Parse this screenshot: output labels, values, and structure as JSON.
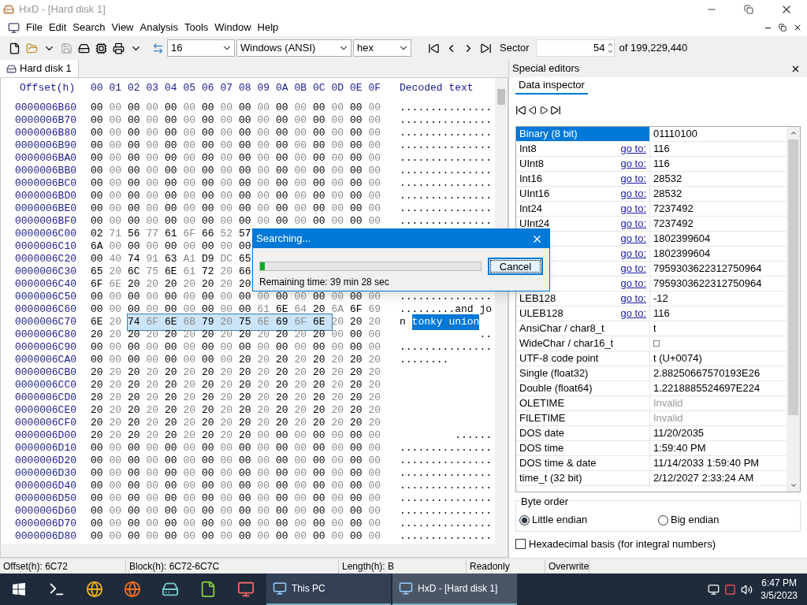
{
  "window": {
    "title": "HxD - [Hard disk 1]"
  },
  "menu": [
    "File",
    "Edit",
    "Search",
    "View",
    "Analysis",
    "Tools",
    "Window",
    "Help"
  ],
  "toolbar": {
    "bytes_per_row": "16",
    "charset": "Windows (ANSI)",
    "offset_base": "hex",
    "sector_label": "Sector",
    "sector": "54",
    "sector_total": "of 199,229,440"
  },
  "document_tab": {
    "label": "Hard disk 1",
    "selected": true
  },
  "hex": {
    "offset_header": "Offset(h)",
    "columns": [
      "00",
      "01",
      "02",
      "03",
      "04",
      "05",
      "06",
      "07",
      "08",
      "09",
      "0A",
      "0B",
      "0C",
      "0D",
      "0E",
      "0F"
    ],
    "decoded_header": "Decoded text",
    "rows": [
      {
        "offset": "0000006B60",
        "bytes": [
          {
            "text": "00 00 00 00 00 00 00 00 00 00 00 00 00 00 00 00",
            "selected": false
          }
        ],
        "decoded": [
          {
            "text": "...............",
            "selected": false
          }
        ]
      },
      {
        "offset": "0000006B70",
        "bytes": [
          {
            "text": "00 00 00 00 00 00 00 00 00 00 00 00 00 00 00 00",
            "selected": false
          }
        ],
        "decoded": [
          {
            "text": "...............",
            "selected": false
          }
        ]
      },
      {
        "offset": "0000006B80",
        "bytes": [
          {
            "text": "00 00 00 00 00 00 00 00 00 00 00 00 00 00 00 00",
            "selected": false
          }
        ],
        "decoded": [
          {
            "text": "...............",
            "selected": false
          }
        ]
      },
      {
        "offset": "0000006B90",
        "bytes": [
          {
            "text": "00 00 00 00 00 00 00 00 00 00 00 00 00 00 00 00",
            "selected": false
          }
        ],
        "decoded": [
          {
            "text": "...............",
            "selected": false
          }
        ]
      },
      {
        "offset": "0000006BA0",
        "bytes": [
          {
            "text": "00 00 00 00 00 00 00 00 00 00 00 00 00 00 00 00",
            "selected": false
          }
        ],
        "decoded": [
          {
            "text": "...............",
            "selected": false
          }
        ]
      },
      {
        "offset": "0000006BB0",
        "bytes": [
          {
            "text": "00 00 00 00 00 00 00 00 00 00 00 00 00 00 00 00",
            "selected": false
          }
        ],
        "decoded": [
          {
            "text": "...............",
            "selected": false
          }
        ]
      },
      {
        "offset": "0000006BC0",
        "bytes": [
          {
            "text": "00 00 00 00 00 00 00 00 00 00 00 00 00 00 00 00",
            "selected": false
          }
        ],
        "decoded": [
          {
            "text": "...............",
            "selected": false
          }
        ]
      },
      {
        "offset": "0000006BD0",
        "bytes": [
          {
            "text": "00 00 00 00 00 00 00 00 00 00 00 00 00 00 00 00",
            "selected": false
          }
        ],
        "decoded": [
          {
            "text": "...............",
            "selected": false
          }
        ]
      },
      {
        "offset": "0000006BE0",
        "bytes": [
          {
            "text": "00 00 00 00 00 00 00 00 00 00 00 00 00 00 00 00",
            "selected": false
          }
        ],
        "decoded": [
          {
            "text": "...............",
            "selected": false
          }
        ]
      },
      {
        "offset": "0000006BF0",
        "bytes": [
          {
            "text": "00 00 00 00 00 00 00 00 00 00 00 00 00 00 00 00",
            "selected": false
          }
        ],
        "decoded": [
          {
            "text": "...............",
            "selected": false
          }
        ]
      },
      {
        "offset": "0000006C00",
        "bytes": [
          {
            "text": "02 71 56 77 61 6F 66 52 57",
            "selected": false
          }
        ]
      },
      {
        "offset": "0000006C10",
        "bytes": [
          {
            "text": "6A 00 00 00 00 00 00 00 00",
            "selected": false
          }
        ]
      },
      {
        "offset": "0000006C20",
        "bytes": [
          {
            "text": "00 40 74 91 63 A1 D9 DC 65",
            "selected": false
          }
        ]
      },
      {
        "offset": "0000006C30",
        "bytes": [
          {
            "text": "65 20 6C 75 6E 61 72 20 66",
            "selected": false
          }
        ]
      },
      {
        "offset": "0000006C40",
        "bytes": [
          {
            "text": "6F 6E 20 20 20 20 20 20 20",
            "selected": false
          }
        ]
      },
      {
        "offset": "0000006C50",
        "bytes": [
          {
            "text": "00 00 00 00 00 00 00 00 00 00 00 00 00 00 00 00",
            "selected": false
          }
        ],
        "decoded": [
          {
            "text": "...............",
            "selected": false
          }
        ]
      },
      {
        "offset": "0000006C60",
        "bytes": [
          {
            "text": "00 00 00 00 00 00 00 00 00 61 6E 64 20 6A 6F 69",
            "selected": false
          }
        ],
        "decoded": [
          {
            "text": ".........and jo",
            "selected": false
          }
        ]
      },
      {
        "offset": "0000006C70",
        "bytes": [
          {
            "text": "6E 20",
            "selected": false
          },
          {
            "text": "74 6F 6E 6B 79 20 75 6E 69 6F 6E",
            "selected": true
          },
          {
            "text": "20 20 20",
            "selected": false
          }
        ],
        "decoded": [
          {
            "text": "n ",
            "selected": false
          },
          {
            "text": "tonky union",
            "selected": true
          }
        ]
      },
      {
        "offset": "0000006C80",
        "bytes": [
          {
            "text": "20 20 20 20 20 20 20 20 20 20 20 20 20 00 00 00",
            "selected": false
          }
        ],
        "decoded": [
          {
            "text": "             ..",
            "selected": false
          }
        ]
      },
      {
        "offset": "0000006C90",
        "bytes": [
          {
            "text": "00 00 00 00 00 00 00 00 00 00 00 00 00 00 00 00",
            "selected": false
          }
        ],
        "decoded": [
          {
            "text": "...............",
            "selected": false
          }
        ]
      },
      {
        "offset": "0000006CA0",
        "bytes": [
          {
            "text": "00 00 00 00 00 00 00 00 20 20 20 20 20 20 20 20",
            "selected": false
          }
        ],
        "decoded": [
          {
            "text": "........",
            "selected": false
          }
        ]
      },
      {
        "offset": "0000006CB0",
        "bytes": [
          {
            "text": "20 20 20 20 20 20 20 20 20 20 20 20 20 20 20 20",
            "selected": false
          }
        ]
      },
      {
        "offset": "0000006CC0",
        "bytes": [
          {
            "text": "20 20 20 20 20 20 20 20 20 20 20 20 20 20 20 20",
            "selected": false
          }
        ]
      },
      {
        "offset": "0000006CD0",
        "bytes": [
          {
            "text": "20 20 20 20 20 20 20 20 20 20 20 20 20 20 20 20",
            "selected": false
          }
        ]
      },
      {
        "offset": "0000006CE0",
        "bytes": [
          {
            "text": "20 20 20 20 20 20 20 20 20 20 20 20 20 20 20 20",
            "selected": false
          }
        ]
      },
      {
        "offset": "0000006CF0",
        "bytes": [
          {
            "text": "20 20 20 20 20 20 20 20 20 20 20 20 20 20 20 20",
            "selected": false
          }
        ]
      },
      {
        "offset": "0000006D00",
        "bytes": [
          {
            "text": "20 20 20 20 20 20 20 20 20 00 00 00 00 00 00 00",
            "selected": false
          }
        ],
        "decoded": [
          {
            "text": "         ......",
            "selected": false
          }
        ]
      },
      {
        "offset": "0000006D10",
        "bytes": [
          {
            "text": "00 00 00 00 00 00 00 00 00 00 00 00 00 00 00 00",
            "selected": false
          }
        ],
        "decoded": [
          {
            "text": "...............",
            "selected": false
          }
        ]
      },
      {
        "offset": "0000006D20",
        "bytes": [
          {
            "text": "00 00 00 00 00 00 00 00 00 00 00 00 00 00 00 00",
            "selected": false
          }
        ],
        "decoded": [
          {
            "text": "...............",
            "selected": false
          }
        ]
      },
      {
        "offset": "0000006D30",
        "bytes": [
          {
            "text": "00 00 00 00 00 00 00 00 00 00 00 00 00 00 00 00",
            "selected": false
          }
        ],
        "decoded": [
          {
            "text": "...............",
            "selected": false
          }
        ]
      },
      {
        "offset": "0000006D40",
        "bytes": [
          {
            "text": "00 00 00 00 00 00 00 00 00 00 00 00 00 00 00 00",
            "selected": false
          }
        ],
        "decoded": [
          {
            "text": "...............",
            "selected": false
          }
        ]
      },
      {
        "offset": "0000006D50",
        "bytes": [
          {
            "text": "00 00 00 00 00 00 00 00 00 00 00 00 00 00 00 00",
            "selected": false
          }
        ],
        "decoded": [
          {
            "text": "...............",
            "selected": false
          }
        ]
      },
      {
        "offset": "0000006D60",
        "bytes": [
          {
            "text": "00 00 00 00 00 00 00 00 00 00 00 00 00 00 00 00",
            "selected": false
          }
        ],
        "decoded": [
          {
            "text": "...............",
            "selected": false
          }
        ]
      },
      {
        "offset": "0000006D70",
        "bytes": [
          {
            "text": "00 00 00 00 00 00 00 00 00 00 00 00 00 00 00 00",
            "selected": false
          }
        ],
        "decoded": [
          {
            "text": "...............",
            "selected": false
          }
        ]
      },
      {
        "offset": "0000006D80",
        "bytes": [
          {
            "text": "00 00 00 00 00 00 00 00 00 00 00 00 00 00 00 00",
            "selected": false
          }
        ],
        "decoded": [
          {
            "text": "...............",
            "selected": false
          }
        ]
      }
    ]
  },
  "dialog": {
    "title": "Searching...",
    "level": 0.02,
    "remaining": "Remaining time: 39 min 28 sec",
    "button": "Cancel"
  },
  "special_editors": {
    "title": "Special editors",
    "tab": {
      "label": "Data inspector",
      "selected": true
    },
    "rows": [
      {
        "label": "Binary (8 bit)",
        "value": "01110100",
        "selected": true,
        "dimmed": false
      },
      {
        "label": "Int8",
        "link": "go to:",
        "value": "116",
        "selected": false,
        "dimmed": false
      },
      {
        "label": "UInt8",
        "link": "go to:",
        "value": "116",
        "selected": false,
        "dimmed": false
      },
      {
        "label": "Int16",
        "link": "go to:",
        "value": "28532",
        "selected": false,
        "dimmed": false
      },
      {
        "label": "UInt16",
        "link": "go to:",
        "value": "28532",
        "selected": false,
        "dimmed": false
      },
      {
        "label": "Int24",
        "link": "go to:",
        "value": "7237492",
        "selected": false,
        "dimmed": false
      },
      {
        "label": "UInt24",
        "link": "go to:",
        "value": "7237492",
        "selected": false,
        "dimmed": false
      },
      {
        "link": "go to:",
        "value": "1802399604",
        "selected": false,
        "dimmed": false
      },
      {
        "link": "go to:",
        "value": "1802399604",
        "selected": false,
        "dimmed": false
      },
      {
        "link": "go to:",
        "value": "7959303622312750964",
        "selected": false,
        "dimmed": false
      },
      {
        "link": "go to:",
        "value": "7959303622312750964",
        "selected": false,
        "dimmed": false
      },
      {
        "label": "LEB128",
        "link": "go to:",
        "value": "-12",
        "selected": false,
        "dimmed": false
      },
      {
        "label": "ULEB128",
        "link": "go to:",
        "value": "116",
        "selected": false,
        "dimmed": false
      },
      {
        "label": "AnsiChar / char8_t",
        "value": "t",
        "selected": false,
        "dimmed": false
      },
      {
        "label": "WideChar / char16_t",
        "value": "□",
        "selected": false,
        "dimmed": false
      },
      {
        "label": "UTF-8 code point",
        "value": "t (U+0074)",
        "selected": false,
        "dimmed": false
      },
      {
        "label": "Single (float32)",
        "value": "2.88250667570193E26",
        "selected": false,
        "dimmed": false
      },
      {
        "label": "Double (float64)",
        "value": "1.2218885524697E224",
        "selected": false,
        "dimmed": false
      },
      {
        "label": "OLETIME",
        "value": "Invalid",
        "selected": false,
        "dimmed": true
      },
      {
        "label": "FILETIME",
        "value": "Invalid",
        "selected": false,
        "dimmed": true
      },
      {
        "label": "DOS date",
        "value": "11/20/2035",
        "selected": false,
        "dimmed": false
      },
      {
        "label": "DOS time",
        "value": "1:59:40 PM",
        "selected": false,
        "dimmed": false
      },
      {
        "label": "DOS time & date",
        "value": "11/14/2033 1:59:40 PM",
        "selected": false,
        "dimmed": false
      },
      {
        "label": "time_t (32 bit)",
        "value": "2/12/2027 2:33:24 AM",
        "selected": false,
        "dimmed": false
      }
    ],
    "byte_order": {
      "title": "Byte order",
      "options": [
        {
          "label": "Little endian",
          "selected": true
        },
        {
          "label": "Big endian",
          "selected": false
        }
      ]
    },
    "hex_basis": {
      "label": "Hexadecimal basis (for integral numbers)",
      "checked": false
    }
  },
  "status_bar": [
    "Offset(h): 6C72",
    "Block(h): 6C72-6C7C",
    "Length(h): B",
    "Readonly",
    "Overwrite"
  ],
  "taskbar": {
    "windows": [
      {
        "label": "This PC",
        "selected": false
      },
      {
        "label": "HxD - [Hard disk 1]",
        "selected": true
      }
    ],
    "time": "6:47 PM",
    "date": "3/5/2023"
  }
}
